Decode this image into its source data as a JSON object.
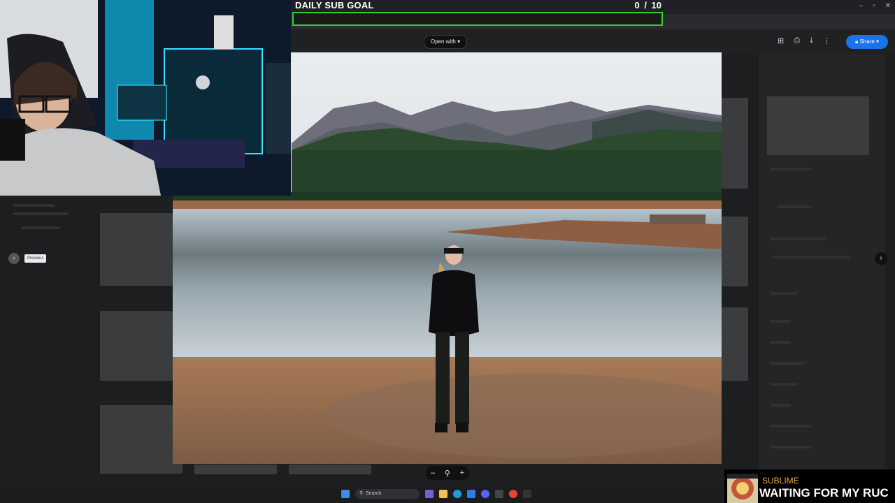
{
  "overlay": {
    "sub_goal_title": "DAILY SUB GOAL",
    "sub_goal_current": "0",
    "sub_goal_target": "/ 10",
    "sub_goal_progress": 0,
    "accent_color": "#33cc33"
  },
  "viewer": {
    "open_with_label": "Open with",
    "share_label": "Share",
    "previous_tooltip": "Previous",
    "icons": [
      "add-comment-icon",
      "print-icon",
      "download-icon",
      "more-vert-icon"
    ]
  },
  "taskbar": {
    "search_placeholder": "Search"
  },
  "now_playing": {
    "artist": "SUBLIME",
    "song": "WAITING FOR MY RUC"
  },
  "colors": {
    "share_blue": "#1a73e8",
    "artist_orange": "#e6a93a"
  }
}
